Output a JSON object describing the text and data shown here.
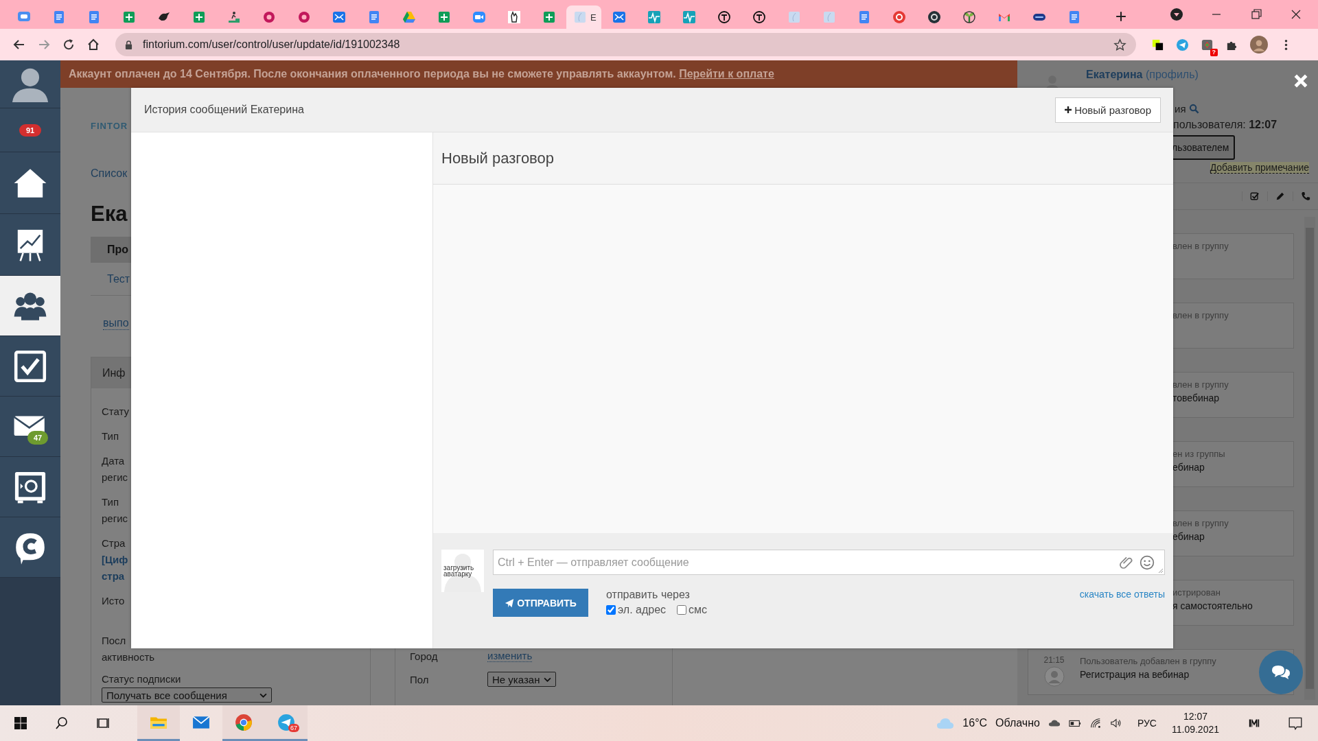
{
  "browser": {
    "tabs": [
      {
        "kind": "chat",
        "selected": false
      },
      {
        "kind": "docs",
        "selected": false
      },
      {
        "kind": "docs",
        "selected": false
      },
      {
        "kind": "sheets",
        "selected": false
      },
      {
        "kind": "bird",
        "selected": false
      },
      {
        "kind": "sheets",
        "selected": false
      },
      {
        "kind": "runner",
        "selected": false
      },
      {
        "kind": "gear",
        "selected": false
      },
      {
        "kind": "gear",
        "selected": false
      },
      {
        "kind": "mail",
        "selected": false
      },
      {
        "kind": "docs",
        "selected": false
      },
      {
        "kind": "drive",
        "selected": false
      },
      {
        "kind": "sheets",
        "selected": false
      },
      {
        "kind": "video",
        "selected": false
      },
      {
        "kind": "hand",
        "selected": false
      },
      {
        "kind": "sheets",
        "selected": false
      },
      {
        "kind": "blank",
        "title": "Е",
        "selected": true
      },
      {
        "kind": "mail",
        "selected": false
      },
      {
        "kind": "pulse",
        "selected": false
      },
      {
        "kind": "pulse",
        "selected": false
      },
      {
        "kind": "ring",
        "selected": false
      },
      {
        "kind": "ring",
        "selected": false
      },
      {
        "kind": "blank",
        "selected": false
      },
      {
        "kind": "blank",
        "selected": false
      },
      {
        "kind": "docs",
        "selected": false
      },
      {
        "kind": "redchat",
        "selected": false
      },
      {
        "kind": "darkcircle",
        "selected": false
      },
      {
        "kind": "sprout",
        "selected": false
      },
      {
        "kind": "gmail",
        "selected": false
      },
      {
        "kind": "pill",
        "selected": false
      },
      {
        "kind": "docs",
        "selected": false
      }
    ],
    "url": "fintorium.com/user/control/user/update/id/191002348",
    "extension_badge": "?"
  },
  "sidebar": {
    "items": [
      {
        "kind": "avatar",
        "selected": false
      },
      {
        "kind": "count",
        "badge": "91",
        "selected": false
      },
      {
        "kind": "home",
        "selected": false
      },
      {
        "kind": "chart",
        "selected": false
      },
      {
        "kind": "users",
        "selected": true
      },
      {
        "kind": "tasks",
        "selected": false
      },
      {
        "kind": "mail",
        "badge": "47",
        "selected": false
      },
      {
        "kind": "safe",
        "selected": false
      },
      {
        "kind": "chat",
        "selected": false
      }
    ]
  },
  "banner": {
    "text": "Аккаунт оплачен до 14 Сентября. После окончания оплаченного периода вы не сможете управлять аккаунтом.",
    "link": "Перейти к оплате"
  },
  "background_page": {
    "logo": "FINTOR",
    "breadcrumb": "Список",
    "heading": "Ека",
    "tabs": [
      {
        "label": "Про",
        "selected": true
      },
      {
        "label": "Тест",
        "selected": false
      }
    ],
    "action_link": "выпо",
    "info_panel": {
      "title": "Инф",
      "fields": [
        {
          "label_lines": [
            "Стату"
          ]
        },
        {
          "label_lines": [
            "Тип"
          ]
        },
        {
          "label_lines": [
            "Дата",
            "регис"
          ]
        },
        {
          "label_lines": [
            "Тип",
            "регис"
          ]
        },
        {
          "label_lines": [
            "Стра"
          ],
          "value_lines": [
            "[Циф",
            "стра"
          ]
        },
        {
          "label_lines": [
            "Исто"
          ]
        },
        {
          "label_lines": [
            "Посл",
            "активность"
          ]
        }
      ],
      "subscription": {
        "label": "Статус подписки",
        "value": "Получать все сообщения"
      }
    },
    "contact_fields": [
      {
        "label": "Город",
        "kind": "link",
        "value": "изменить"
      },
      {
        "label": "Пол",
        "kind": "select",
        "value": "Не указан"
      }
    ]
  },
  "modal": {
    "title": "История сообщений Екатерина",
    "new_button": "Новый разговор",
    "conversation_title": "Новый разговор",
    "composer": {
      "avatar_caption": "загрузить аватарку",
      "placeholder": "Ctrl + Enter — отправляет сообщение",
      "send_button": "ОТПРАВИТЬ",
      "via_label": "отправить через",
      "channels": [
        {
          "label": "эл. адрес",
          "checked": true
        },
        {
          "label": "смс",
          "checked": false
        }
      ],
      "download_link": "скачать все ответы"
    }
  },
  "user_panel": {
    "name": "**Екатерина** (профиль)",
    "search_fragment": "ия",
    "time_line": "пользователя: **12:07**",
    "button_fragment": "льзователем",
    "note_link": "Добавить примечание",
    "feed": [
      {
        "kind": "clipped",
        "lines": [
          "влен в группу"
        ]
      },
      {
        "kind": "clipped",
        "lines": [
          "влен в группу"
        ]
      },
      {
        "kind": "clipped",
        "lines": [
          "влен в группу",
          "товебинар"
        ]
      },
      {
        "kind": "clipped",
        "lines": [
          "ен из группы",
          "ебинар"
        ]
      },
      {
        "kind": "clipped",
        "lines": [
          "влен в группу",
          "ебинар"
        ]
      },
      {
        "kind": "clipped",
        "lines": [
          "истрирован",
          "я самостоятельно"
        ]
      },
      {
        "kind": "full",
        "time": "21:15",
        "title": "Пользователь добавлен в группу",
        "detail": "Регистрация на вебинар"
      }
    ]
  },
  "taskbar": {
    "apps": [
      {
        "kind": "explorer",
        "active": true
      },
      {
        "kind": "mail",
        "active": false
      },
      {
        "kind": "chrome",
        "active": true
      },
      {
        "kind": "telegram",
        "active": true,
        "badge": "67"
      }
    ],
    "temperature": "16°C",
    "weather": "Облачно",
    "language": "РУС",
    "time": "12:07",
    "date": "11.09.2021"
  }
}
